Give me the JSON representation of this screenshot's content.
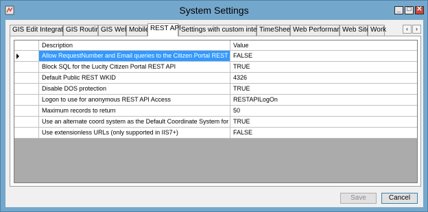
{
  "window": {
    "title": "System Settings"
  },
  "tabs": [
    {
      "label": "GIS Edit Integration"
    },
    {
      "label": "GIS Routing"
    },
    {
      "label": "GIS Web"
    },
    {
      "label": "Mobile"
    },
    {
      "label": "REST API",
      "active": true
    },
    {
      "label": "Settings with custom interface"
    },
    {
      "label": "TimeSheet"
    },
    {
      "label": "Web Performance"
    },
    {
      "label": "Web Site"
    },
    {
      "label": "Work"
    }
  ],
  "grid": {
    "headers": {
      "description": "Description",
      "value": "Value"
    },
    "rows": [
      {
        "description": "Allow RequestNumber and Email queries to the Citizen Portal REST API witho...",
        "value": "FALSE"
      },
      {
        "description": "Block SQL for the Lucity Citizen Portal REST API",
        "value": "TRUE"
      },
      {
        "description": "Default Public REST WKID",
        "value": "4326"
      },
      {
        "description": "Disable DOS protection",
        "value": "TRUE"
      },
      {
        "description": "Logon to use for anonymous REST API Access",
        "value": "RESTAPILogOn"
      },
      {
        "description": "Maximum records to return",
        "value": "50"
      },
      {
        "description": "Use an alternate coord system as the Default Coordinate System for Public R...",
        "value": "TRUE"
      },
      {
        "description": "Use extensionless URLs (only supported in IIS7+)",
        "value": "FALSE"
      }
    ]
  },
  "buttons": {
    "save": "Save",
    "cancel": "Cancel"
  },
  "icons": {
    "app": "settings-app-icon",
    "scroll_left": "chevron-left-icon",
    "scroll_right": "chevron-right-icon"
  },
  "colors": {
    "selection": "#3399ff",
    "titlebar": "#74a7cc",
    "close": "#c9483e"
  }
}
